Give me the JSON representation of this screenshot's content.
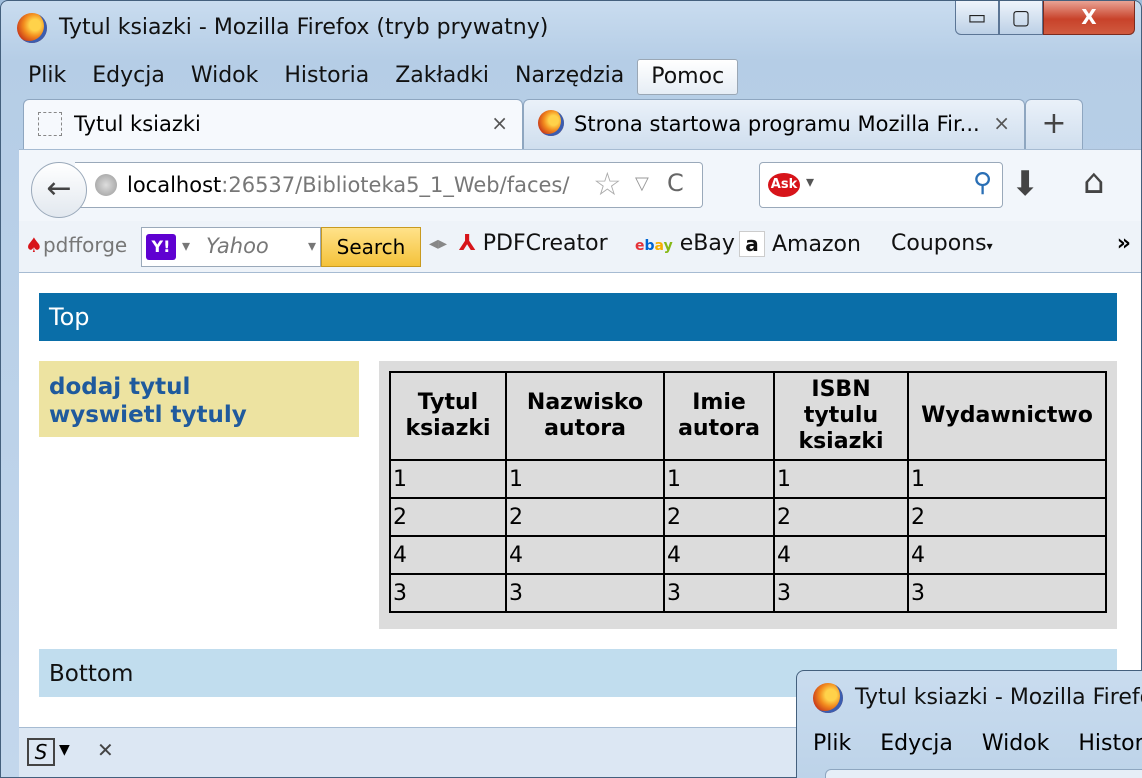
{
  "window": {
    "title": "Tytul ksiazki - Mozilla Firefox (tryb prywatny)",
    "minimize": "▭",
    "maximize": "▢",
    "close": "X"
  },
  "menu": [
    "Plik",
    "Edycja",
    "Widok",
    "Historia",
    "Zakładki",
    "Narzędzia",
    "Pomoc"
  ],
  "tabs": [
    {
      "label": "Tytul ksiazki",
      "close": "×"
    },
    {
      "label": "Strona startowa programu Mozilla Fir...",
      "close": "×"
    }
  ],
  "new_tab": "+",
  "address": {
    "host": "localhost",
    "rest": ":26537/Biblioteka5_1_Web/faces/"
  },
  "bookmarks": {
    "pdfforge": "pdfforge",
    "yahoo_logo": "Y!",
    "yahoo_placeholder": "Yahoo",
    "search_button": "Search",
    "pdfcreator": "PDFCreator",
    "ebay": "eBay",
    "amazon": "Amazon",
    "coupons": "Coupons"
  },
  "page": {
    "top": "Top",
    "bottom": "Bottom",
    "nav": [
      "dodaj tytul",
      "wyswietl tytuly"
    ]
  },
  "table": {
    "headers": [
      [
        "Tytul",
        "ksiazki"
      ],
      [
        "Nazwisko",
        "autora"
      ],
      [
        "Imie",
        "autora"
      ],
      [
        "ISBN",
        "tytulu",
        "ksiazki"
      ],
      [
        "Wydawnictwo"
      ]
    ],
    "rows": [
      [
        "1",
        "1",
        "1",
        "1",
        "1"
      ],
      [
        "2",
        "2",
        "2",
        "2",
        "2"
      ],
      [
        "4",
        "4",
        "4",
        "4",
        "4"
      ],
      [
        "3",
        "3",
        "3",
        "3",
        "3"
      ]
    ]
  },
  "second_window": {
    "title": "Tytul ksiazki - Mozilla Firefo",
    "menu": [
      "Plik",
      "Edycja",
      "Widok",
      "Histori"
    ]
  },
  "colors": {
    "top_bar": "#0a6ea8",
    "nav_bg": "#ede3a1",
    "link": "#1f5a9d",
    "bottom_bar": "#c1ddee",
    "table_bg": "#dcdcdc"
  }
}
